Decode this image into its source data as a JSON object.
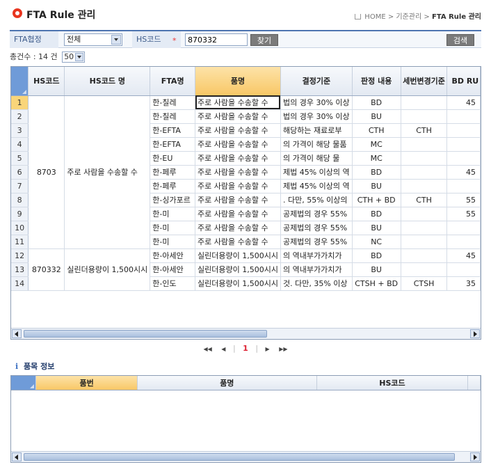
{
  "header": {
    "title": "FTA Rule 관리",
    "breadcrumb": [
      "HOME",
      "기준관리",
      "FTA Rule 관리"
    ],
    "breadcrumb_sep": ">"
  },
  "search": {
    "fta_label": "FTA협정",
    "fta_value": "전체",
    "hs_label": "HS코드",
    "required_mark": "*",
    "hs_value": "870332",
    "find_button": "찾기",
    "search_button": "검색"
  },
  "summary": {
    "count_text": "총건수 : 14 건",
    "page_size": "50"
  },
  "grid": {
    "columns": [
      "HS코드",
      "HS코드 명",
      "FTA명",
      "품명",
      "결정기준",
      "판정 내용",
      "세번변경기준",
      "BD RU"
    ],
    "groups": [
      {
        "hs": "8703",
        "hs_name": "주로 사람을 수송할 수",
        "start": 0,
        "span": 11
      },
      {
        "hs": "870332",
        "hs_name": "실린더용량이 1,500시시",
        "start": 11,
        "span": 3
      }
    ],
    "rows": [
      {
        "no": "1",
        "fta": "한-칠레",
        "name": "주로 사람을 수송할 수",
        "criteria": "법의 경우 30% 이상",
        "result": "BD",
        "tariff": "",
        "bd": "45"
      },
      {
        "no": "2",
        "fta": "한-칠레",
        "name": "주로 사람을 수송할 수",
        "criteria": "법의 경우 30% 이상",
        "result": "BU",
        "tariff": "",
        "bd": ""
      },
      {
        "no": "3",
        "fta": "한-EFTA",
        "name": "주로 사람을 수송할 수",
        "criteria": "해당하는 재료로부",
        "result": "CTH",
        "tariff": "CTH",
        "bd": ""
      },
      {
        "no": "4",
        "fta": "한-EFTA",
        "name": "주로 사람을 수송할 수",
        "criteria": "의 가격이 해당 물품",
        "result": "MC",
        "tariff": "",
        "bd": ""
      },
      {
        "no": "5",
        "fta": "한-EU",
        "name": "주로 사람을 수송할 수",
        "criteria": "의 가격이 해당 물",
        "result": "MC",
        "tariff": "",
        "bd": ""
      },
      {
        "no": "6",
        "fta": "한-페루",
        "name": "주로 사람을 수송할 수",
        "criteria": "제법 45% 이상의 역",
        "result": "BD",
        "tariff": "",
        "bd": "45"
      },
      {
        "no": "7",
        "fta": "한-페루",
        "name": "주로 사람을 수송할 수",
        "criteria": "제법 45% 이상의 역",
        "result": "BU",
        "tariff": "",
        "bd": ""
      },
      {
        "no": "8",
        "fta": "한-싱가포르",
        "name": "주로 사람을 수송할 수",
        "criteria": ". 다만, 55% 이상의",
        "result": "CTH + BD",
        "tariff": "CTH",
        "bd": "55"
      },
      {
        "no": "9",
        "fta": "한-미",
        "name": "주로 사람을 수송할 수",
        "criteria": "공제법의 경우 55%",
        "result": "BD",
        "tariff": "",
        "bd": "55"
      },
      {
        "no": "10",
        "fta": "한-미",
        "name": "주로 사람을 수송할 수",
        "criteria": "공제법의 경우 55%",
        "result": "BU",
        "tariff": "",
        "bd": ""
      },
      {
        "no": "11",
        "fta": "한-미",
        "name": "주로 사람을 수송할 수",
        "criteria": "공제법의 경우 55%",
        "result": "NC",
        "tariff": "",
        "bd": ""
      },
      {
        "no": "12",
        "fta": "한-아세안",
        "name": "실린더용량이 1,500시시",
        "criteria": "의 역내부가가치가",
        "result": "BD",
        "tariff": "",
        "bd": "45"
      },
      {
        "no": "13",
        "fta": "한-아세안",
        "name": "실린더용량이 1,500시시",
        "criteria": "의 역내부가가치가",
        "result": "BU",
        "tariff": "",
        "bd": ""
      },
      {
        "no": "14",
        "fta": "한-인도",
        "name": "실린더용량이 1,500시시",
        "criteria": "것. 다만, 35% 이상",
        "result": "CTSH + BD",
        "tariff": "CTSH",
        "bd": "35"
      }
    ]
  },
  "pager": {
    "first": "◀◀",
    "prev": "◀",
    "current": "1",
    "next": "▶",
    "last": "▶▶"
  },
  "items_section": {
    "title": "품목 정보",
    "columns": [
      "품번",
      "품명",
      "HS코드"
    ]
  }
}
